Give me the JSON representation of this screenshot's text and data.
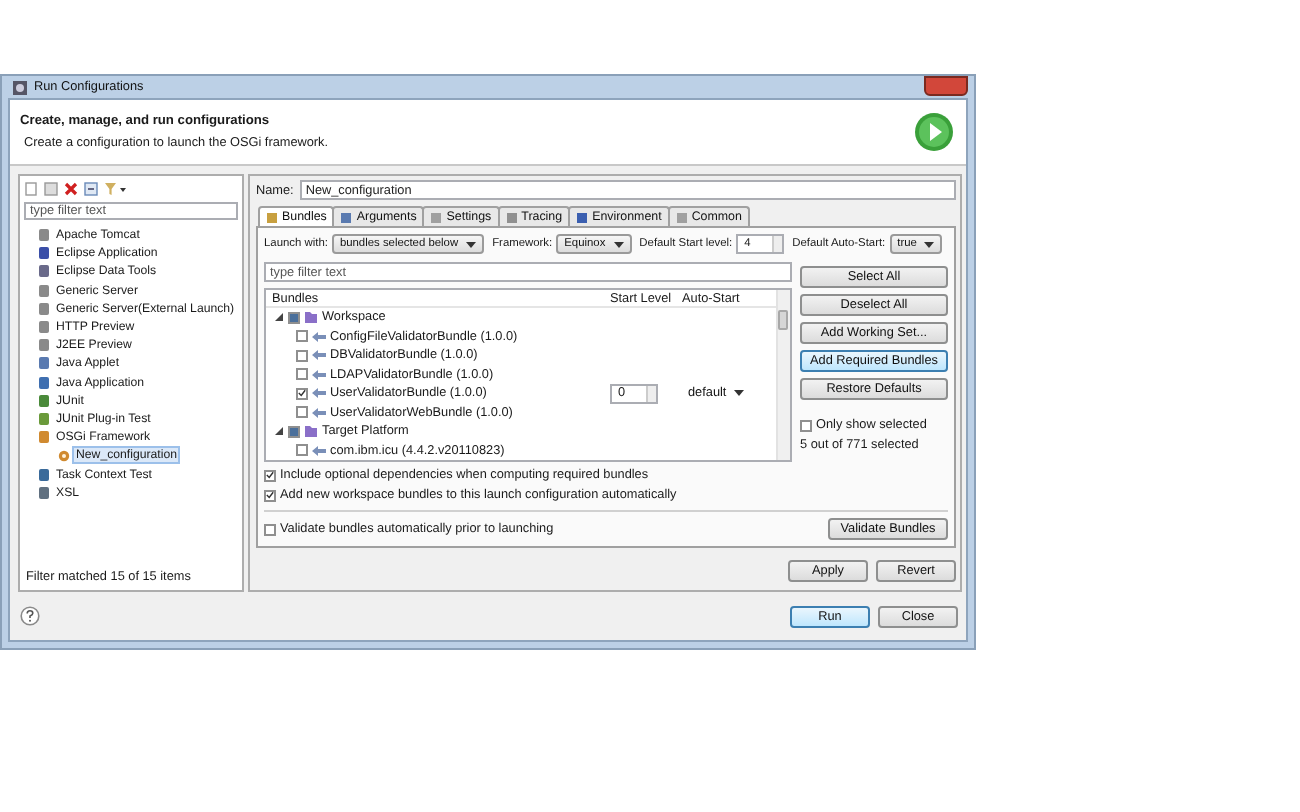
{
  "window": {
    "title": "Run Configurations"
  },
  "header": {
    "title": "Create, manage, and run configurations",
    "subtitle": "Create a configuration to launch the OSGi framework."
  },
  "sidebar": {
    "filter_placeholder": "type filter text",
    "status": "Filter matched 15 of 15 items",
    "items": [
      {
        "label": "Apache Tomcat",
        "selected": false
      },
      {
        "label": "Eclipse Application",
        "selected": false
      },
      {
        "label": "Eclipse Data Tools",
        "selected": false
      },
      {
        "label": "Generic Server",
        "selected": false
      },
      {
        "label": "Generic Server(External Launch)",
        "selected": false
      },
      {
        "label": "HTTP Preview",
        "selected": false
      },
      {
        "label": "J2EE Preview",
        "selected": false
      },
      {
        "label": "Java Applet",
        "selected": false
      },
      {
        "label": "Java Application",
        "selected": false
      },
      {
        "label": "JUnit",
        "selected": false
      },
      {
        "label": "JUnit Plug-in Test",
        "selected": false
      },
      {
        "label": "OSGi Framework",
        "selected": false,
        "children": [
          {
            "label": "New_configuration",
            "selected": true
          }
        ]
      },
      {
        "label": "Task Context Test",
        "selected": false
      },
      {
        "label": "XSL",
        "selected": false
      }
    ]
  },
  "name": {
    "label": "Name:",
    "value": "New_configuration"
  },
  "tabs": [
    {
      "label": "Bundles",
      "selected": true
    },
    {
      "label": "Arguments",
      "selected": false
    },
    {
      "label": "Settings",
      "selected": false
    },
    {
      "label": "Tracing",
      "selected": false
    },
    {
      "label": "Environment",
      "selected": false
    },
    {
      "label": "Common",
      "selected": false
    }
  ],
  "launch_row": [
    {
      "label": "Launch with:",
      "kind": "select",
      "value": "bundles selected below"
    },
    {
      "label": "Framework:",
      "kind": "select",
      "value": "Equinox"
    },
    {
      "label": "Default Start level:",
      "kind": "spinner",
      "value": "4"
    },
    {
      "label": "Default Auto-Start:",
      "kind": "select",
      "value": "true"
    }
  ],
  "bundle_filter": {
    "placeholder": "type filter text"
  },
  "bundles": {
    "columns": [
      "Bundles",
      "Start Level",
      "Auto-Start"
    ],
    "rows": [
      {
        "label": "Workspace",
        "checked": true,
        "grayed": true,
        "expanded": true,
        "children": [
          {
            "label": "ConfigFileValidatorBundle (1.0.0)",
            "checked": false
          },
          {
            "label": "DBValidatorBundle (1.0.0)",
            "checked": false
          },
          {
            "label": "LDAPValidatorBundle (1.0.0)",
            "checked": false
          },
          {
            "label": "UserValidatorBundle (1.0.0)",
            "checked": true,
            "start_level": "0",
            "auto_start": "default"
          },
          {
            "label": "UserValidatorWebBundle (1.0.0)",
            "checked": false
          }
        ]
      },
      {
        "label": "Target Platform",
        "checked": true,
        "grayed": true,
        "expanded": true,
        "children": [
          {
            "label": "com.ibm.icu (4.4.2.v20110823)",
            "checked": false
          }
        ]
      }
    ]
  },
  "side_buttons": [
    {
      "label": "Select All",
      "focused": false
    },
    {
      "label": "Deselect All",
      "focused": false
    },
    {
      "label": "Add Working Set...",
      "focused": false
    },
    {
      "label": "Add Required Bundles",
      "focused": true
    },
    {
      "label": "Restore Defaults",
      "focused": false
    }
  ],
  "only_show_selected": {
    "label": "Only show selected",
    "checked": false
  },
  "selection_count": "5 out of 771 selected",
  "options": [
    {
      "label": "Include optional dependencies when computing required bundles",
      "checked": true
    },
    {
      "label": "Add new workspace bundles to this launch configuration automatically",
      "checked": true
    }
  ],
  "validate": {
    "label": "Validate bundles automatically prior to launching",
    "checked": false,
    "button": "Validate Bundles"
  },
  "apply_buttons": [
    "Apply",
    "Revert"
  ],
  "footer_buttons": [
    {
      "label": "Run",
      "default": true
    },
    {
      "label": "Close",
      "default": false
    }
  ]
}
